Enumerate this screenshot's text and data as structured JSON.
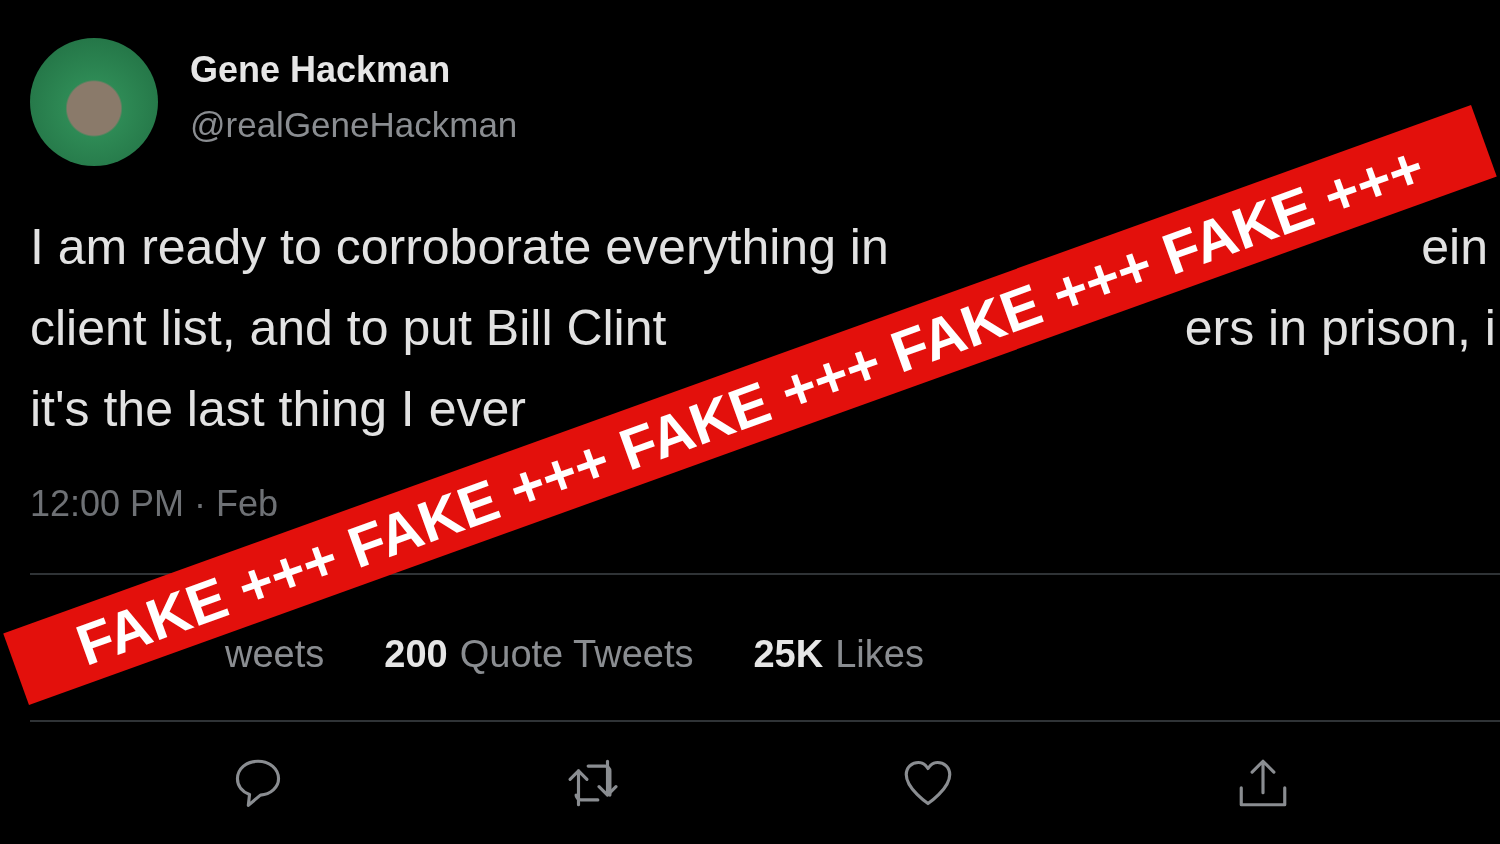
{
  "tweet": {
    "author": {
      "name": "Gene Hackman",
      "handle": "@realGeneHackman"
    },
    "text_lines": [
      {
        "segments": [
          "I am ready to corroborate everything in",
          "ein"
        ]
      },
      {
        "segments": [
          "client list, and to put Bill Clint",
          "ers in prison, i"
        ]
      },
      {
        "segments": [
          "it's the last thing I ever"
        ]
      }
    ],
    "timestamp": "12:00 PM · Feb",
    "stats": [
      {
        "label": "weets"
      },
      {
        "count": "200",
        "label": "Quote Tweets"
      },
      {
        "count": "25K",
        "label": "Likes"
      }
    ],
    "actions": [
      {
        "kind": "reply"
      },
      {
        "kind": "retweet"
      },
      {
        "kind": "like"
      },
      {
        "kind": "share"
      }
    ]
  },
  "banner": {
    "text": "FAKE +++ FAKE +++ FAKE +++ FAKE +++ FAKE +++"
  }
}
